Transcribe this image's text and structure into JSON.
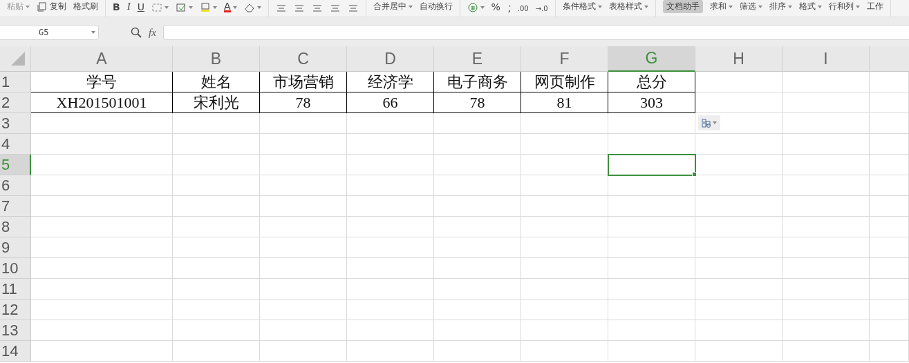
{
  "toolbar": {
    "groups": [
      [
        {
          "kind": "text",
          "label": "粘贴",
          "dropdown": true,
          "disabled": true,
          "highlighted": false
        },
        {
          "kind": "copy",
          "label": "复制",
          "dropdown": false,
          "disabled": false,
          "highlighted": false
        },
        {
          "kind": "text",
          "label": "格式刷",
          "dropdown": false,
          "disabled": false,
          "highlighted": false
        }
      ],
      [
        {
          "kind": "bold",
          "label": "B",
          "dropdown": false,
          "disabled": false,
          "highlighted": false
        },
        {
          "kind": "italic",
          "label": "I",
          "dropdown": false,
          "disabled": false,
          "highlighted": false
        },
        {
          "kind": "underline",
          "label": "U",
          "dropdown": false,
          "disabled": false,
          "highlighted": false
        },
        {
          "kind": "border",
          "dropdown": true,
          "disabled": false,
          "highlighted": false
        },
        {
          "kind": "fill",
          "dropdown": true,
          "disabled": false,
          "highlighted": false
        },
        {
          "kind": "highlight",
          "dropdown": true,
          "disabled": false,
          "highlighted": false
        },
        {
          "kind": "fontcolor",
          "label": "A",
          "dropdown": true,
          "disabled": false,
          "highlighted": false
        },
        {
          "kind": "eraser",
          "dropdown": true,
          "disabled": false,
          "highlighted": false
        }
      ],
      [
        {
          "kind": "align",
          "dropdown": false,
          "disabled": false,
          "highlighted": false
        },
        {
          "kind": "align",
          "dropdown": false,
          "disabled": false,
          "highlighted": false
        },
        {
          "kind": "align",
          "dropdown": false,
          "disabled": false,
          "highlighted": false
        },
        {
          "kind": "align",
          "dropdown": false,
          "disabled": false,
          "highlighted": false
        },
        {
          "kind": "align",
          "dropdown": false,
          "disabled": false,
          "highlighted": false
        }
      ],
      [
        {
          "kind": "text",
          "label": "合并居中",
          "dropdown": true,
          "disabled": false,
          "highlighted": false
        },
        {
          "kind": "text",
          "label": "自动换行",
          "dropdown": false,
          "disabled": false,
          "highlighted": false
        }
      ],
      [
        {
          "kind": "currency",
          "dropdown": true,
          "disabled": false,
          "highlighted": false
        },
        {
          "kind": "percent",
          "label": "%",
          "dropdown": false,
          "disabled": false,
          "highlighted": false
        },
        {
          "kind": "comma",
          "dropdown": false,
          "disabled": false,
          "highlighted": false
        },
        {
          "kind": "decimal",
          "label": ".00",
          "dropdown": false,
          "disabled": false,
          "highlighted": false
        },
        {
          "kind": "decimal",
          "label": "→.0",
          "dropdown": false,
          "disabled": false,
          "highlighted": false
        }
      ],
      [
        {
          "kind": "text",
          "label": "条件格式",
          "dropdown": true,
          "disabled": false,
          "highlighted": false
        },
        {
          "kind": "text",
          "label": "表格样式",
          "dropdown": true,
          "disabled": false,
          "highlighted": false
        }
      ],
      [
        {
          "kind": "text",
          "label": "文档助手",
          "dropdown": false,
          "disabled": false,
          "highlighted": true
        },
        {
          "kind": "text",
          "label": "求和",
          "dropdown": true,
          "disabled": false,
          "highlighted": false
        },
        {
          "kind": "text",
          "label": "筛选",
          "dropdown": true,
          "disabled": false,
          "highlighted": false
        },
        {
          "kind": "text",
          "label": "排序",
          "dropdown": true,
          "disabled": false,
          "highlighted": false
        },
        {
          "kind": "text",
          "label": "格式",
          "dropdown": true,
          "disabled": false,
          "highlighted": false
        },
        {
          "kind": "text",
          "label": "行和列",
          "dropdown": true,
          "disabled": false,
          "highlighted": false
        },
        {
          "kind": "text",
          "label": "工作",
          "dropdown": false,
          "disabled": false,
          "highlighted": false
        }
      ]
    ]
  },
  "formula_bar": {
    "name_box": "G5",
    "fx": "fx"
  },
  "columns": [
    {
      "label": "A",
      "selected": false
    },
    {
      "label": "B",
      "selected": false
    },
    {
      "label": "C",
      "selected": false
    },
    {
      "label": "D",
      "selected": false
    },
    {
      "label": "E",
      "selected": false
    },
    {
      "label": "F",
      "selected": false
    },
    {
      "label": "G",
      "selected": true
    },
    {
      "label": "H",
      "selected": false
    },
    {
      "label": "I",
      "selected": false
    }
  ],
  "rows": [
    {
      "label": "1",
      "selected": false,
      "cells": [
        "学号",
        "姓名",
        "市场营销",
        "经济学",
        "电子商务",
        "网页制作",
        "总分"
      ]
    },
    {
      "label": "2",
      "selected": false,
      "cells": [
        "XH201501001",
        "宋利光",
        "78",
        "66",
        "78",
        "81",
        "303"
      ]
    },
    {
      "label": "3",
      "selected": false,
      "cells": []
    },
    {
      "label": "4",
      "selected": false,
      "cells": []
    },
    {
      "label": "5",
      "selected": true,
      "cells": []
    },
    {
      "label": "6",
      "selected": false,
      "cells": []
    },
    {
      "label": "7",
      "selected": false,
      "cells": []
    },
    {
      "label": "8",
      "selected": false,
      "cells": []
    },
    {
      "label": "9",
      "selected": false,
      "cells": []
    },
    {
      "label": "10",
      "selected": false,
      "cells": []
    },
    {
      "label": "11",
      "selected": false,
      "cells": []
    },
    {
      "label": "12",
      "selected": false,
      "cells": []
    },
    {
      "label": "13",
      "selected": false,
      "cells": []
    },
    {
      "label": "14",
      "selected": false,
      "cells": []
    }
  ],
  "paste_options": {
    "dropdown": true
  }
}
